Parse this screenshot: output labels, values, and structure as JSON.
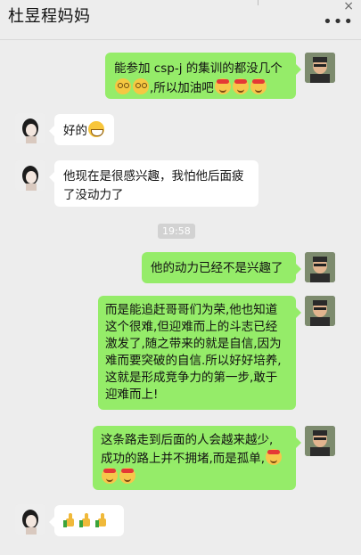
{
  "header": {
    "title": "杜昱程妈妈",
    "close_glyph": "×",
    "more_glyph": "•••"
  },
  "messages": [
    {
      "from": "me",
      "text": "能参加 csp-j 的集训的都没几个",
      "text2": ",所以加油吧",
      "emojis_pre": [
        "dizzy-face",
        "dizzy-face"
      ],
      "emojis_post": [
        "fist-headband",
        "fist-headband",
        "fist-headband"
      ]
    },
    {
      "from": "mom",
      "text": "好的",
      "emojis_post": [
        "grin"
      ]
    },
    {
      "from": "mom",
      "line1": "他现在是很感兴趣，我怕他后面疲",
      "line2": "了没动力了"
    },
    {
      "time": "19:58"
    },
    {
      "from": "me",
      "text": "他的动力已经不是兴趣了"
    },
    {
      "from": "me",
      "lines": [
        "而是能追赶哥哥们为荣,他也知道",
        "这个很难,但迎难而上的斗志已经",
        "激发了,随之带来的就是自信,因为",
        "难而要突破的自信.所以好好培养,",
        "这就是形成竞争力的第一步,敢于",
        "迎难而上!"
      ]
    },
    {
      "from": "me",
      "line1": "这条路走到后面的人会越来越少,",
      "line2": "成功的路上并不拥堵,而是孤单,",
      "emojis_end": [
        "fist-headband"
      ],
      "emojis_line3": [
        "fist-headband",
        "fist-headband"
      ]
    },
    {
      "from": "mom",
      "emojis": [
        "thumbs-up",
        "thumbs-up",
        "thumbs-up"
      ]
    }
  ],
  "colors": {
    "background": "#ededed",
    "bubble_me": "#95ec69",
    "bubble_other": "#ffffff"
  }
}
